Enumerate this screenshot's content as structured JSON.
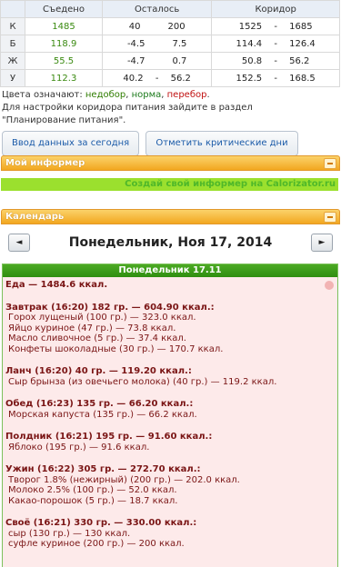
{
  "table": {
    "headers": [
      "Съедено",
      "Осталось",
      "Коридор"
    ],
    "rows": [
      {
        "k": "К",
        "eaten": "1485",
        "left_a": "40",
        "left_b": "200",
        "cor_a": "1525",
        "cor_b": "1685"
      },
      {
        "k": "Б",
        "eaten": "118.9",
        "left_a": "-4.5",
        "left_b": "7.5",
        "cor_a": "114.4",
        "cor_b": "126.4"
      },
      {
        "k": "Ж",
        "eaten": "55.5",
        "left_a": "-4.7",
        "left_b": "0.7",
        "cor_a": "50.8",
        "cor_b": "56.2"
      },
      {
        "k": "У",
        "eaten": "112.3",
        "left_a": "40.2",
        "left_b": "56.2",
        "cor_a": "152.5",
        "cor_b": "168.5"
      }
    ],
    "dash": "-"
  },
  "legend": {
    "prefix": "Цвета означают: ",
    "nedobor": "недобор",
    "comma": ", ",
    "norma": "норма",
    "perebor": "перебор",
    "dot": ".",
    "line2": "Для настройки коридора питания зайдите в раздел",
    "line3": "\"Планирование питания\"."
  },
  "buttons": {
    "today": "Ввод данных за сегодня",
    "critical": "Отметить критические дни"
  },
  "informer": {
    "title": "Мой информер",
    "link": "Создай свой информер на Calorizator.ru"
  },
  "calendar": {
    "title": "Календарь",
    "prev": "◄",
    "next": "►",
    "date": "Понедельник, Ноя 17, 2014",
    "day_header": "Понедельник 17.11"
  },
  "meals": [
    {
      "head": "Еда — 1484.6 ккал.",
      "items": []
    },
    {
      "head": "Завтрак (16:20) 182 гр. — 604.90 ккал.:",
      "items": [
        "Горох лущеный (100 гр.) — 323.0 ккал.",
        "Яйцо куриное (47 гр.) — 73.8 ккал.",
        "Масло сливочное (5 гр.) — 37.4 ккал.",
        "Конфеты шоколадные (30 гр.) — 170.7 ккал."
      ]
    },
    {
      "head": "Ланч (16:20) 40 гр. — 119.20 ккал.:",
      "items": [
        "Сыр брынза (из овечьего молока) (40 гр.) — 119.2 ккал."
      ]
    },
    {
      "head": "Обед (16:23) 135 гр. — 66.20 ккал.:",
      "items": [
        "Морская капуста (135 гр.) — 66.2 ккал."
      ]
    },
    {
      "head": "Полдник (16:21) 195 гр. — 91.60 ккал.:",
      "items": [
        "Яблоко (195 гр.) — 91.6 ккал."
      ]
    },
    {
      "head": "Ужин (16:22) 305 гр. — 272.70 ккал.:",
      "items": [
        "Творог 1.8% (нежирный) (200 гр.) — 202.0 ккал.",
        "Молоко 2.5% (100 гр.) — 52.0 ккал.",
        "Какао-порошок (5 гр.) — 18.7 ккал."
      ]
    },
    {
      "head": "Своё (16:21) 330 гр. — 330.00 ккал.:",
      "items": [
        "сыр (130 гр.) — 130 ккал.",
        "суфле куриное (200 гр.) — 200 ккал."
      ]
    }
  ]
}
